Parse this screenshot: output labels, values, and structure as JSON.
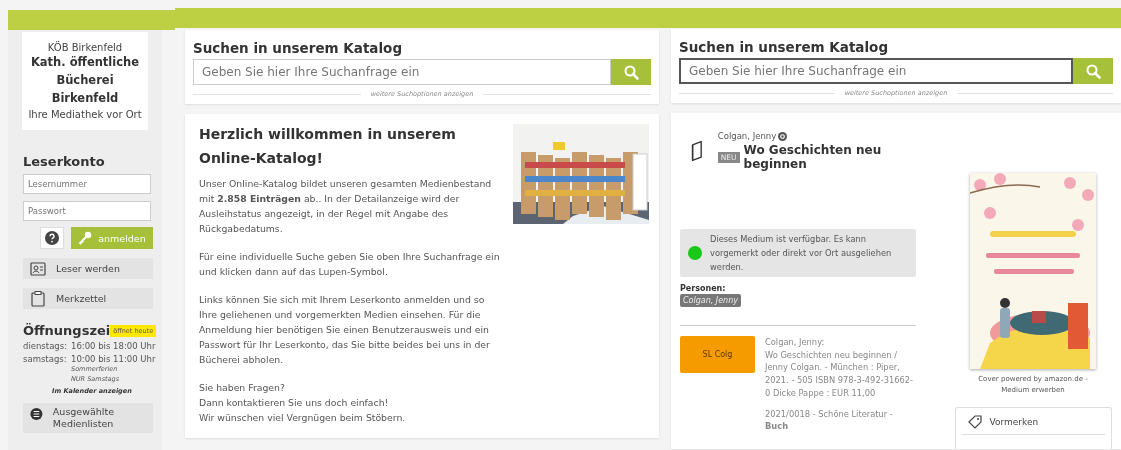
{
  "sidebar": {
    "library": {
      "owner": "KÖB Birkenfeld",
      "name": "Kath. öffentliche Bücherei Birkenfeld",
      "tagline": "Ihre Mediathek vor Ort"
    },
    "account": {
      "title": "Leserkonto",
      "fields": [
        {
          "placeholder": "Lesernummer"
        },
        {
          "placeholder": "Passwort"
        }
      ],
      "login_button": "anmelden"
    },
    "links": [
      {
        "kind": "register",
        "label": "Leser werden"
      },
      {
        "kind": "notepad",
        "label": "Merkzettel"
      }
    ],
    "opening_hours": {
      "title": "Öffnungszei",
      "badge": "öffnet heute",
      "rows": [
        {
          "day": "dienstags:",
          "time": "16:00 bis 18:00 Uhr"
        },
        {
          "day": "samstags:",
          "time": "10:00 bis 11:00 Uhr",
          "note": "Sommerferien NUR Samstags"
        }
      ],
      "calendar_link": "Im Kalender anzeigen"
    },
    "lists_link": {
      "kind": "lists",
      "label": "Ausgewählte Medienlisten"
    }
  },
  "home_page": {
    "search": {
      "title": "Suchen in unserem Katalog",
      "placeholder": "Geben Sie hier Ihre Suchanfrage ein",
      "focused": false,
      "more_options": "weitere Suchoptionen anzeigen"
    },
    "welcome": {
      "title": "Herzlich willkommen in unserem Online-Katalog!",
      "paragraphs": [
        "Unser Online-Katalog bildet unseren gesamten Medienbestand mit **2.858 Einträgen** ab.. In der Detailanzeige wird der Ausleihstatus angezeigt, in der Regel mit Angabe des Rückgabedatums.",
        "Für eine individuelle Suche geben Sie oben Ihre Suchanfrage ein und klicken dann auf das Lupen-Symbol.",
        "Links können Sie sich mit Ihrem Leserkonto anmelden und so Ihre geliehenen und vorgemerkten Medien einsehen. Für die Anmeldung hier benötigen Sie einen Benutzerausweis und ein Passwort für Ihr Leserkonto, das Sie bitte beides bei uns in der Bücherei abholen.",
        "Sie haben Fragen?\nDann kontaktieren Sie uns doch einfach!\nWir wünschen viel Vergnügen beim Stöbern."
      ]
    }
  },
  "detail_page": {
    "search": {
      "title": "Suchen in unserem Katalog",
      "placeholder": "Geben Sie hier Ihre Suchanfrage ein",
      "focused": true,
      "more_options": "weitere Suchoptionen anzeigen"
    },
    "item": {
      "author": "Colgan, Jenny",
      "badge": "NEU",
      "title": "Wo Geschichten neu beginnen",
      "availability": {
        "available": true,
        "text": "Dieses Medium ist verfügbar. Es kann vorgemerkt oder direkt vor Ort ausgeliehen werden."
      },
      "persons_label": "Personen:",
      "persons": [
        "Colgan, Jenny"
      ],
      "signature": "SL Colg",
      "description": [
        "Colgan, Jenny:",
        "Wo Geschichten neu beginnen / Jenny Colgan. - München : Piper, 2021. - 505 ISBN 978-3-492-31662-0 Dicke Pappe : EUR 11,00"
      ],
      "classification": "2021/0018 - Schöne Literatur - **Buch**",
      "cover_caption": "Cover powered by amazon.de - Medium erwerben",
      "actions": [
        {
          "label": "Vormerken"
        }
      ]
    }
  }
}
